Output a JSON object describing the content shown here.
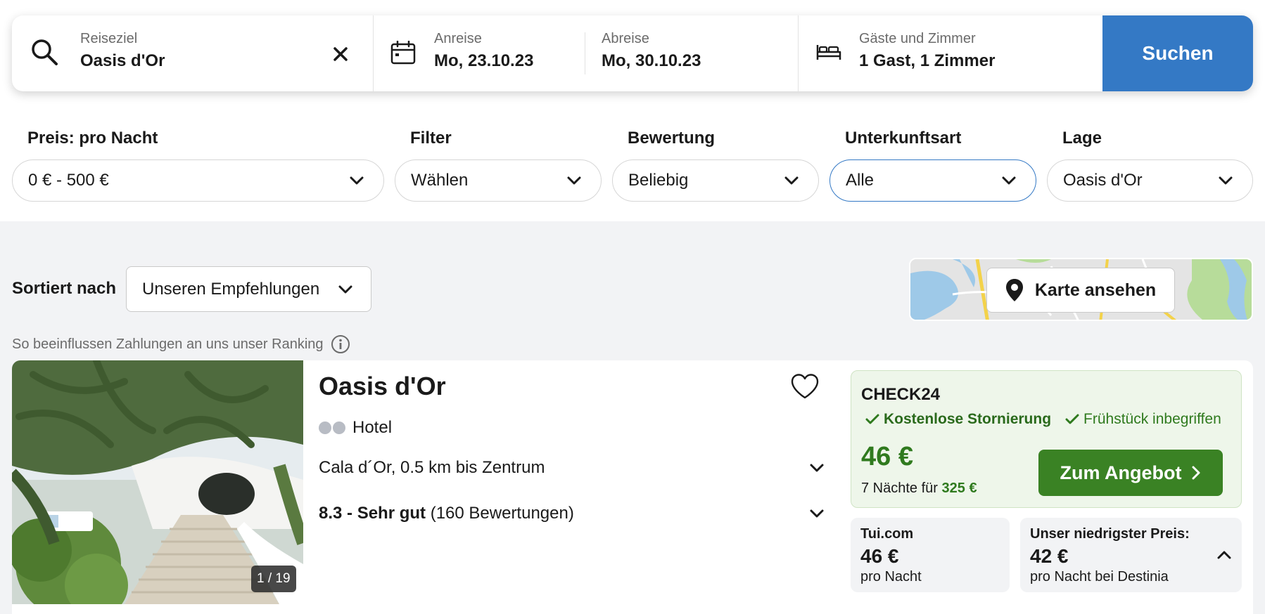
{
  "search": {
    "destination_label": "Reiseziel",
    "destination_value": "Oasis d'Or",
    "checkin_label": "Anreise",
    "checkin_value": "Mo, 23.10.23",
    "checkout_label": "Abreise",
    "checkout_value": "Mo, 30.10.23",
    "guests_label": "Gäste und Zimmer",
    "guests_value": "1 Gast, 1 Zimmer",
    "search_button": "Suchen",
    "icons": [
      "search-icon",
      "close-icon",
      "calendar-icon",
      "bed-icon"
    ]
  },
  "filters": [
    {
      "label": "Preis: pro Nacht",
      "value": "0 € - 500 €"
    },
    {
      "label": "Filter",
      "value": "Wählen"
    },
    {
      "label": "Bewertung",
      "value": "Beliebig"
    },
    {
      "label": "Unterkunftsart",
      "value": "Alle"
    },
    {
      "label": "Lage",
      "value": "Oasis d'Or"
    }
  ],
  "sort": {
    "label": "Sortiert nach",
    "value": "Unseren Empfehlungen"
  },
  "map": {
    "button_label": "Karte ansehen"
  },
  "ranking_note": "So beeinflussen Zahlungen an uns unser Ranking",
  "hotel": {
    "name": "Oasis d'Or",
    "type": "Hotel",
    "location": "Cala d´Or, 0.5 km bis Zentrum",
    "rating_score": "8.3 - Sehr gut",
    "rating_count": " (160 Bewertungen)",
    "photo_counter": "1 / 19",
    "offer": {
      "provider": "CHECK24",
      "perk_1": "Kostenlose Stornierung",
      "perk_2": "Frühstück inbegriffen",
      "price": "46 €",
      "nights_text": "7 Nächte für ",
      "total_price": "325 €",
      "button": "Zum Angebot"
    },
    "alt_offers": [
      {
        "provider": "Tui.com",
        "price": "46 €",
        "sub": "pro Nacht"
      },
      {
        "provider": "Unser niedrigster Preis:",
        "price": "42 €",
        "sub": "pro Nacht bei Destinia"
      }
    ]
  },
  "colors": {
    "primary_blue": "#3479c5",
    "offer_green": "#3a8224",
    "price_green": "#2f7a1e",
    "offer_bg": "#eef6ea",
    "page_bg": "#f2f3f5"
  }
}
